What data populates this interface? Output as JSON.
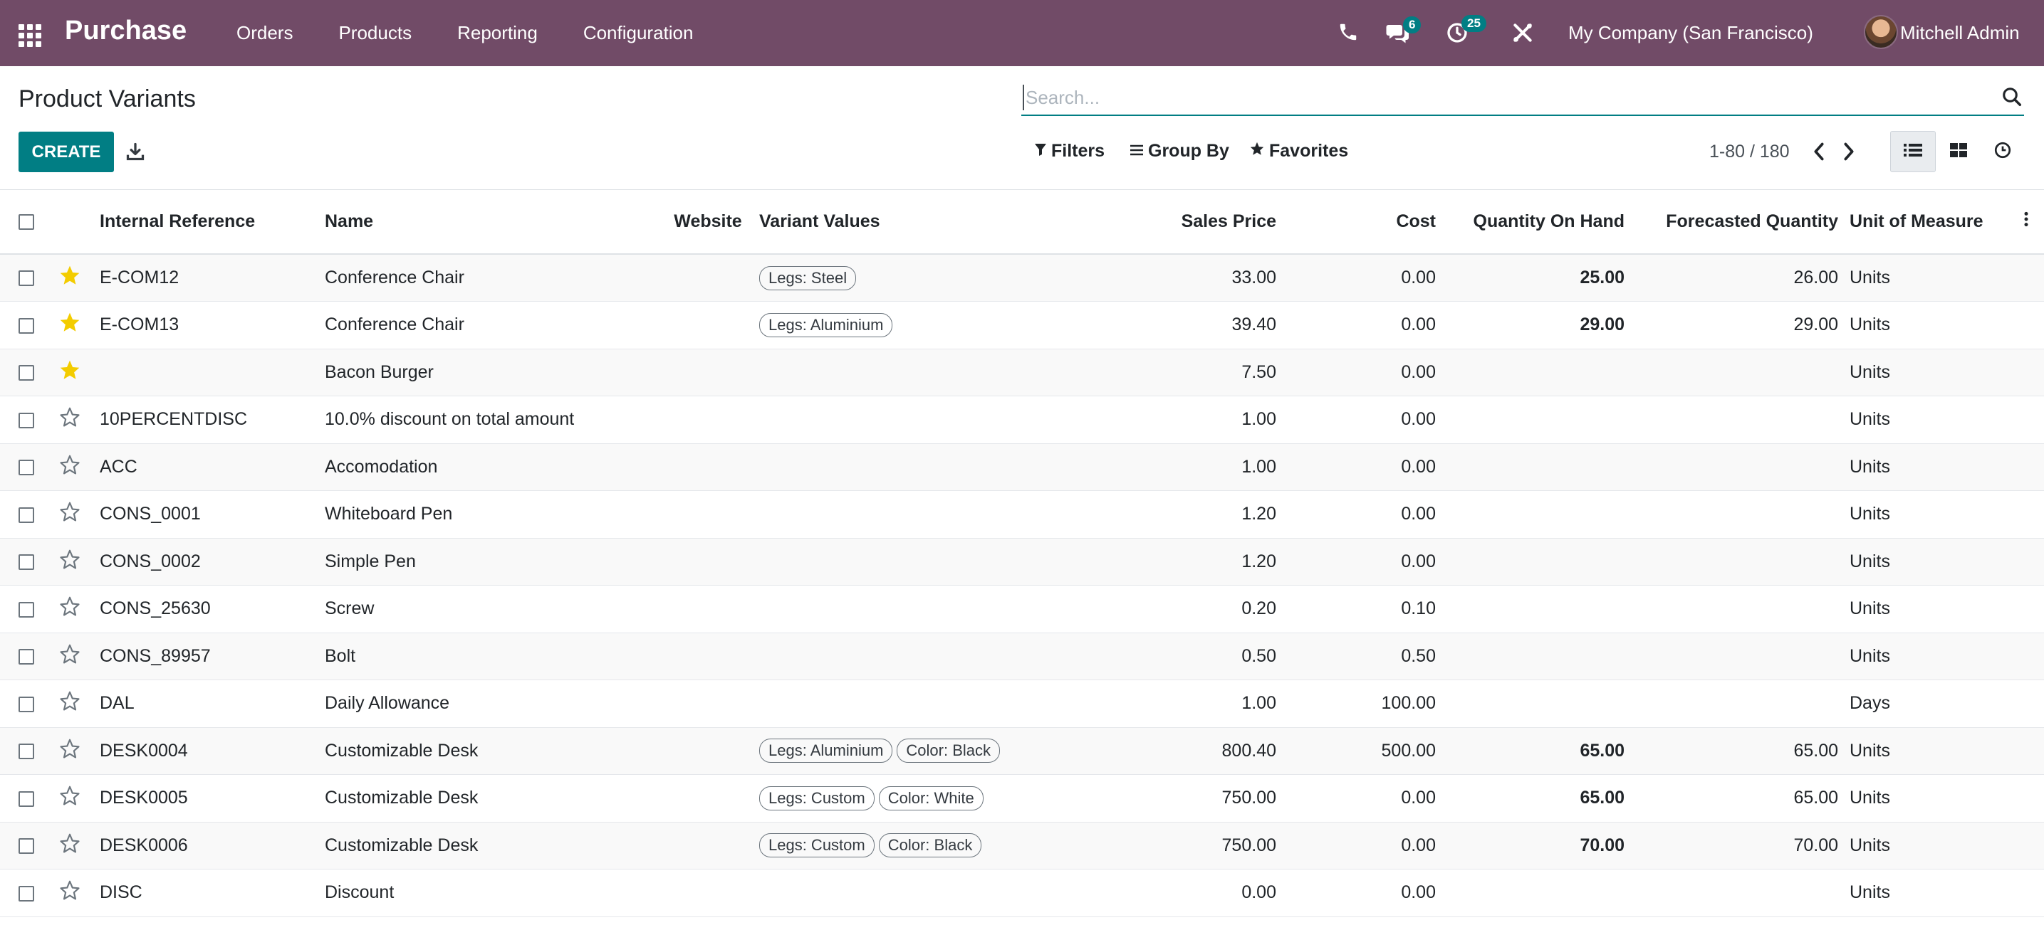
{
  "navbar": {
    "app_name": "Purchase",
    "menu": [
      "Orders",
      "Products",
      "Reporting",
      "Configuration"
    ],
    "messages_count": "6",
    "activities_count": "25",
    "company": "My Company (San Francisco)",
    "user": "Mitchell Admin",
    "bg_color": "#714b67"
  },
  "control": {
    "title": "Product Variants",
    "search_placeholder": "Search...",
    "create_label": "CREATE",
    "filters_label": "Filters",
    "groupby_label": "Group By",
    "favorites_label": "Favorites",
    "pager_value": "1-80 / 180",
    "accent_color": "#017e84"
  },
  "table": {
    "headers": {
      "internal_reference": "Internal Reference",
      "name": "Name",
      "website": "Website",
      "variant_values": "Variant Values",
      "sales_price": "Sales Price",
      "cost": "Cost",
      "qty_on_hand": "Quantity On Hand",
      "forecasted": "Forecasted Quantity",
      "uom": "Unit of Measure"
    },
    "rows": [
      {
        "favorite": true,
        "ref": "E-COM12",
        "name": "Conference Chair",
        "tags": [
          "Legs: Steel"
        ],
        "price": "33.00",
        "cost": "0.00",
        "onhand": "25.00",
        "forecast": "26.00",
        "uom": "Units"
      },
      {
        "favorite": true,
        "ref": "E-COM13",
        "name": "Conference Chair",
        "tags": [
          "Legs: Aluminium"
        ],
        "price": "39.40",
        "cost": "0.00",
        "onhand": "29.00",
        "forecast": "29.00",
        "uom": "Units"
      },
      {
        "favorite": true,
        "ref": "",
        "name": "Bacon Burger",
        "tags": [],
        "price": "7.50",
        "cost": "0.00",
        "onhand": "",
        "forecast": "",
        "uom": "Units"
      },
      {
        "favorite": false,
        "ref": "10PERCENTDISC",
        "name": "10.0% discount on total amount",
        "tags": [],
        "price": "1.00",
        "cost": "0.00",
        "onhand": "",
        "forecast": "",
        "uom": "Units"
      },
      {
        "favorite": false,
        "ref": "ACC",
        "name": "Accomodation",
        "tags": [],
        "price": "1.00",
        "cost": "0.00",
        "onhand": "",
        "forecast": "",
        "uom": "Units"
      },
      {
        "favorite": false,
        "ref": "CONS_0001",
        "name": "Whiteboard Pen",
        "tags": [],
        "price": "1.20",
        "cost": "0.00",
        "onhand": "",
        "forecast": "",
        "uom": "Units"
      },
      {
        "favorite": false,
        "ref": "CONS_0002",
        "name": "Simple Pen",
        "tags": [],
        "price": "1.20",
        "cost": "0.00",
        "onhand": "",
        "forecast": "",
        "uom": "Units"
      },
      {
        "favorite": false,
        "ref": "CONS_25630",
        "name": "Screw",
        "tags": [],
        "price": "0.20",
        "cost": "0.10",
        "onhand": "",
        "forecast": "",
        "uom": "Units"
      },
      {
        "favorite": false,
        "ref": "CONS_89957",
        "name": "Bolt",
        "tags": [],
        "price": "0.50",
        "cost": "0.50",
        "onhand": "",
        "forecast": "",
        "uom": "Units"
      },
      {
        "favorite": false,
        "ref": "DAL",
        "name": "Daily Allowance",
        "tags": [],
        "price": "1.00",
        "cost": "100.00",
        "onhand": "",
        "forecast": "",
        "uom": "Days"
      },
      {
        "favorite": false,
        "ref": "DESK0004",
        "name": "Customizable Desk",
        "tags": [
          "Legs: Aluminium",
          "Color: Black"
        ],
        "price": "800.40",
        "cost": "500.00",
        "onhand": "65.00",
        "forecast": "65.00",
        "uom": "Units"
      },
      {
        "favorite": false,
        "ref": "DESK0005",
        "name": "Customizable Desk",
        "tags": [
          "Legs: Custom",
          "Color: White"
        ],
        "price": "750.00",
        "cost": "0.00",
        "onhand": "65.00",
        "forecast": "65.00",
        "uom": "Units"
      },
      {
        "favorite": false,
        "ref": "DESK0006",
        "name": "Customizable Desk",
        "tags": [
          "Legs: Custom",
          "Color: Black"
        ],
        "price": "750.00",
        "cost": "0.00",
        "onhand": "70.00",
        "forecast": "70.00",
        "uom": "Units"
      },
      {
        "favorite": false,
        "ref": "DISC",
        "name": "Discount",
        "tags": [],
        "price": "0.00",
        "cost": "0.00",
        "onhand": "",
        "forecast": "",
        "uom": "Units"
      }
    ],
    "star_color": "#f3cc00"
  }
}
